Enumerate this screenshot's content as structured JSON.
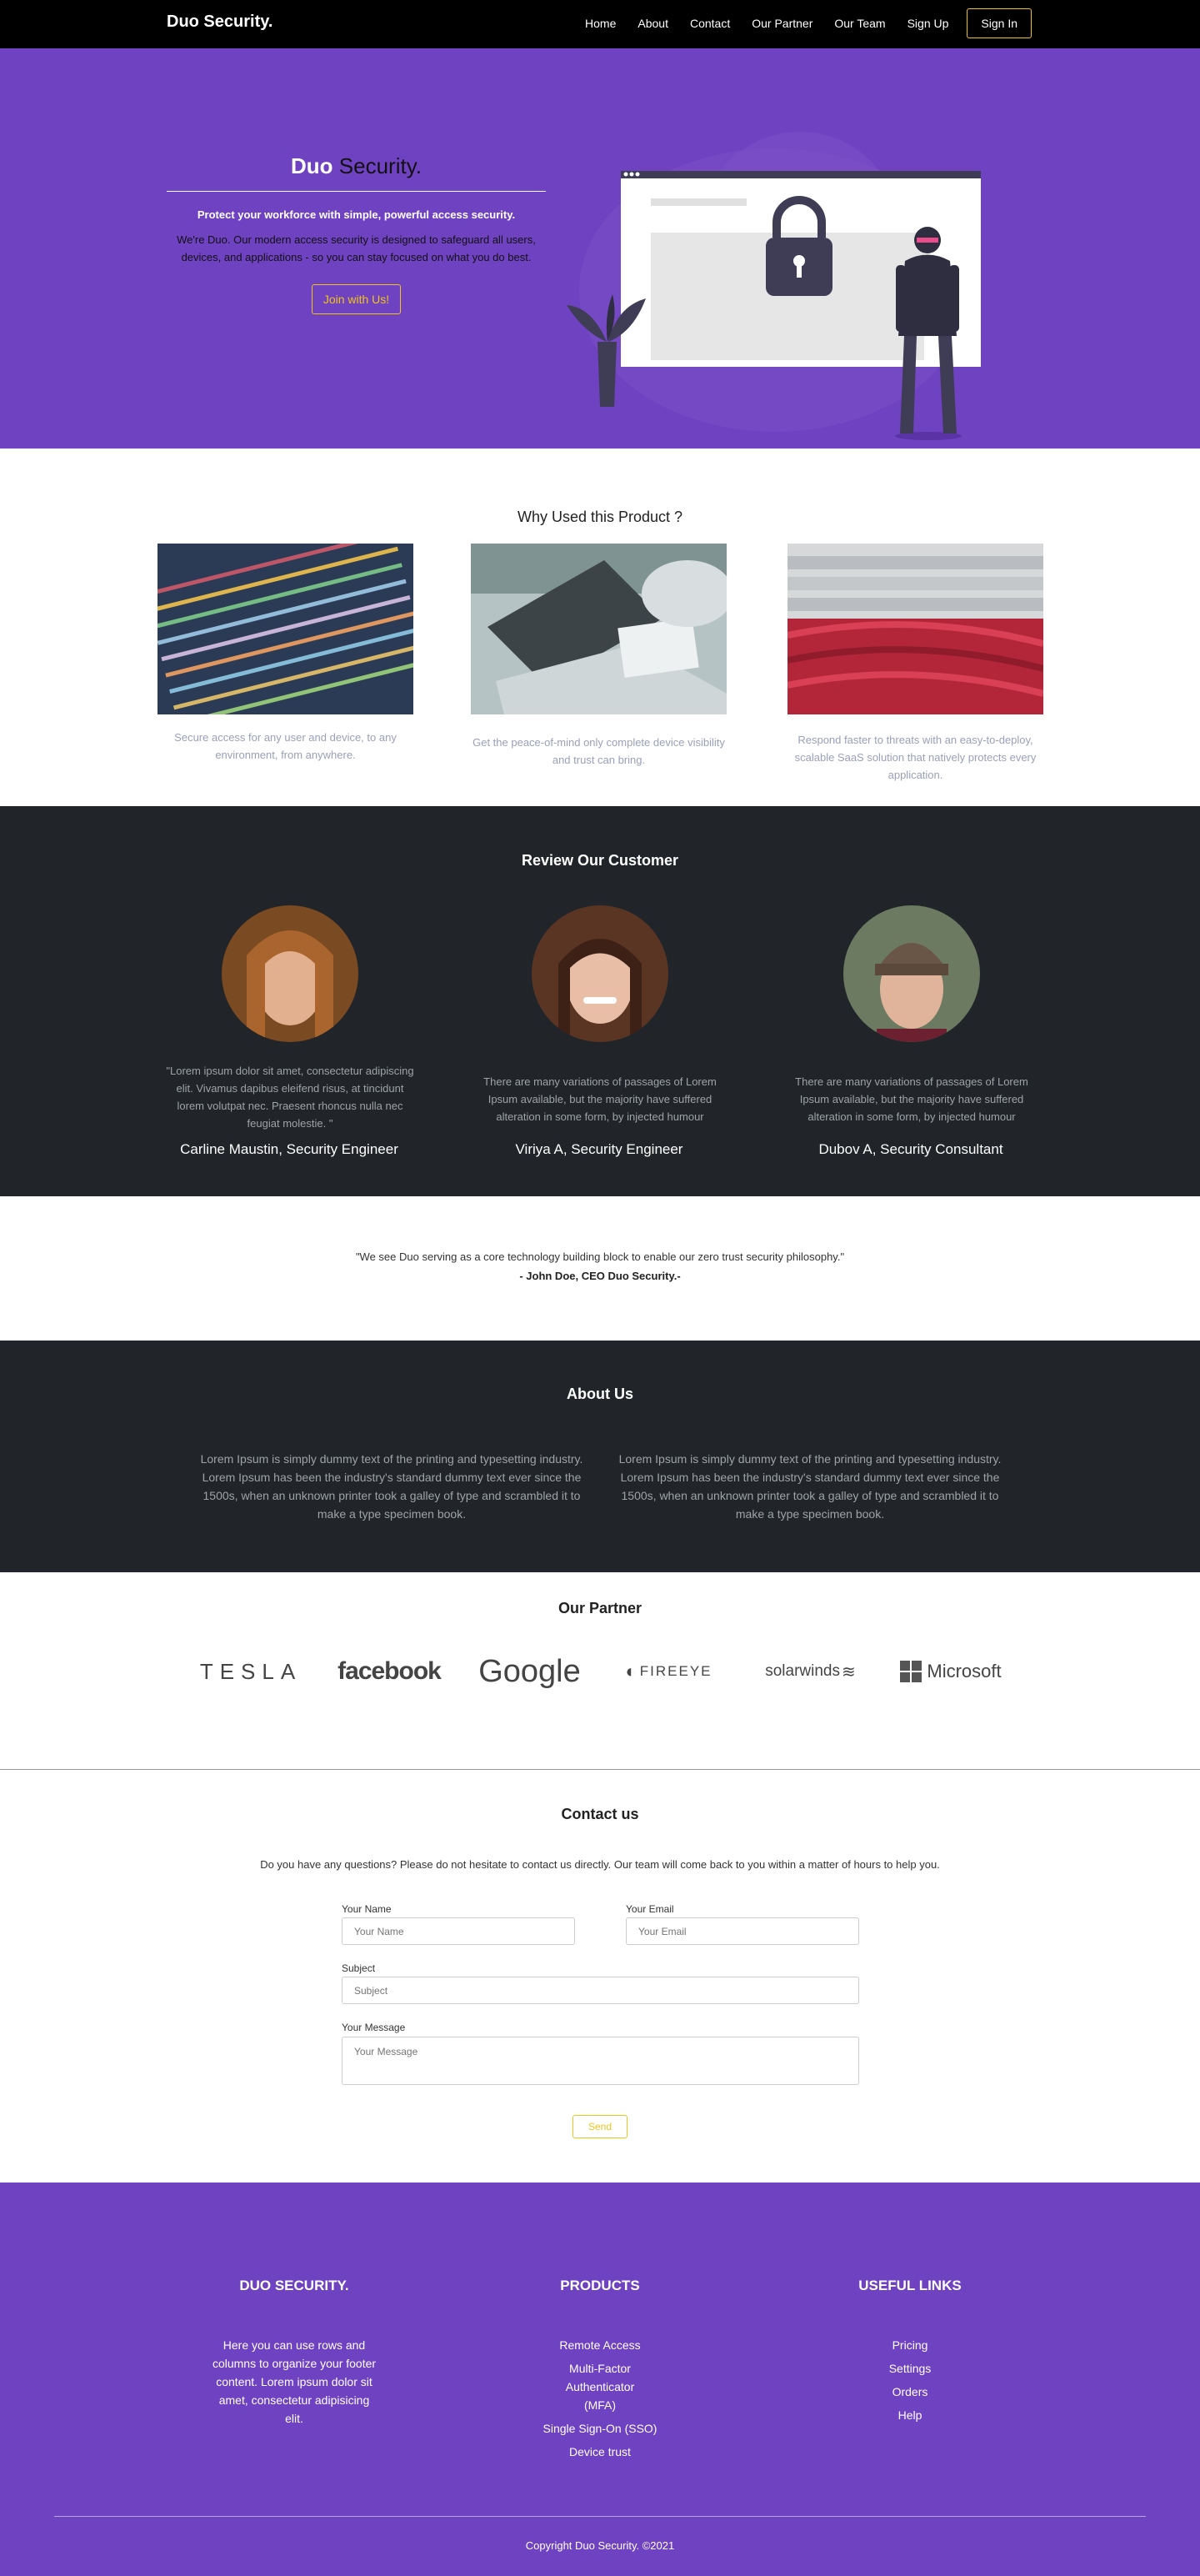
{
  "nav": {
    "brand": "Duo Security.",
    "links": [
      "Home",
      "About",
      "Contact",
      "Our Partner",
      "Our Team",
      "Sign Up"
    ],
    "signin": "Sign In"
  },
  "hero": {
    "title_bold": "Duo",
    "title_rest": " Security.",
    "strong": "Protect your workforce with simple, powerful access security.",
    "desc": "We're Duo. Our modern access security is designed to safeguard all users, devices, and applications - so you can stay focused on what you do best.",
    "button": "Join with Us!"
  },
  "why": {
    "title": "Why Used this Product ?",
    "cards": [
      "Secure access for any user and device, to any environment, from anywhere.",
      "Get the peace-of-mind only complete device visibility and trust can bring.",
      "Respond faster to threats with an easy-to-deploy, scalable SaaS solution that natively protects every application."
    ]
  },
  "reviews": {
    "title": "Review Our Customer",
    "items": [
      {
        "text": "\"Lorem ipsum dolor sit amet, consectetur adipiscing elit. Vivamus dapibus eleifend risus, at tincidunt lorem volutpat nec. Praesent rhoncus nulla nec feugiat molestie. \"",
        "name": "Carline Maustin, Security Engineer"
      },
      {
        "text": "There are many variations of passages of Lorem Ipsum available, but the majority have suffered alteration in some form, by injected humour",
        "name": "Viriya A, Security Engineer"
      },
      {
        "text": "There are many variations of passages of Lorem Ipsum available, but the majority have suffered alteration in some form, by injected humour",
        "name": "Dubov A, Security Consultant"
      }
    ]
  },
  "quote": {
    "text": "\"We see Duo serving as a core technology building block to enable our zero trust security philosophy.\"",
    "by": "- John Doe, CEO Duo Security.-"
  },
  "about": {
    "title": "About Us",
    "cols": [
      "Lorem Ipsum is simply dummy text of the printing and typesetting industry. Lorem Ipsum has been the industry's standard dummy text ever since the 1500s, when an unknown printer took a galley of type and scrambled it to make a type specimen book.",
      "Lorem Ipsum is simply dummy text of the printing and typesetting industry. Lorem Ipsum has been the industry's standard dummy text ever since the 1500s, when an unknown printer took a galley of type and scrambled it to make a type specimen book."
    ]
  },
  "partner": {
    "title": "Our Partner",
    "logos": [
      "TESLA",
      "facebook",
      "Google",
      "FIREEYE",
      "solarwinds",
      "Microsoft"
    ]
  },
  "contact": {
    "title": "Contact us",
    "intro": "Do you have any questions? Please do not hesitate to contact us directly. Our team will come back to you within a matter of hours to help you.",
    "name_label": "Your Name",
    "name_placeholder": "Your Name",
    "email_label": "Your Email",
    "email_placeholder": "Your Email",
    "subject_label": "Subject",
    "subject_placeholder": "Subject",
    "message_label": "Your Message",
    "message_placeholder": "Your Message",
    "send": "Send"
  },
  "footer": {
    "col1_title": "DUO SECURITY.",
    "col1_text": "Here you can use rows and columns to organize your footer content. Lorem ipsum dolor sit amet, consectetur adipisicing elit.",
    "col2_title": "PRODUCTS",
    "col2_items": [
      "Remote Access",
      "Multi-Factor Authenticator (MFA)",
      "Single Sign-On (SSO)",
      "Device trust"
    ],
    "col3_title": "USEFUL LINKS",
    "col3_items": [
      "Pricing",
      "Settings",
      "Orders",
      "Help"
    ],
    "copyright": "Copyright Duo Security. ©2021"
  },
  "colors": {
    "purple": "#6f42c1",
    "dark": "#212529",
    "accent": "#f0c419"
  }
}
